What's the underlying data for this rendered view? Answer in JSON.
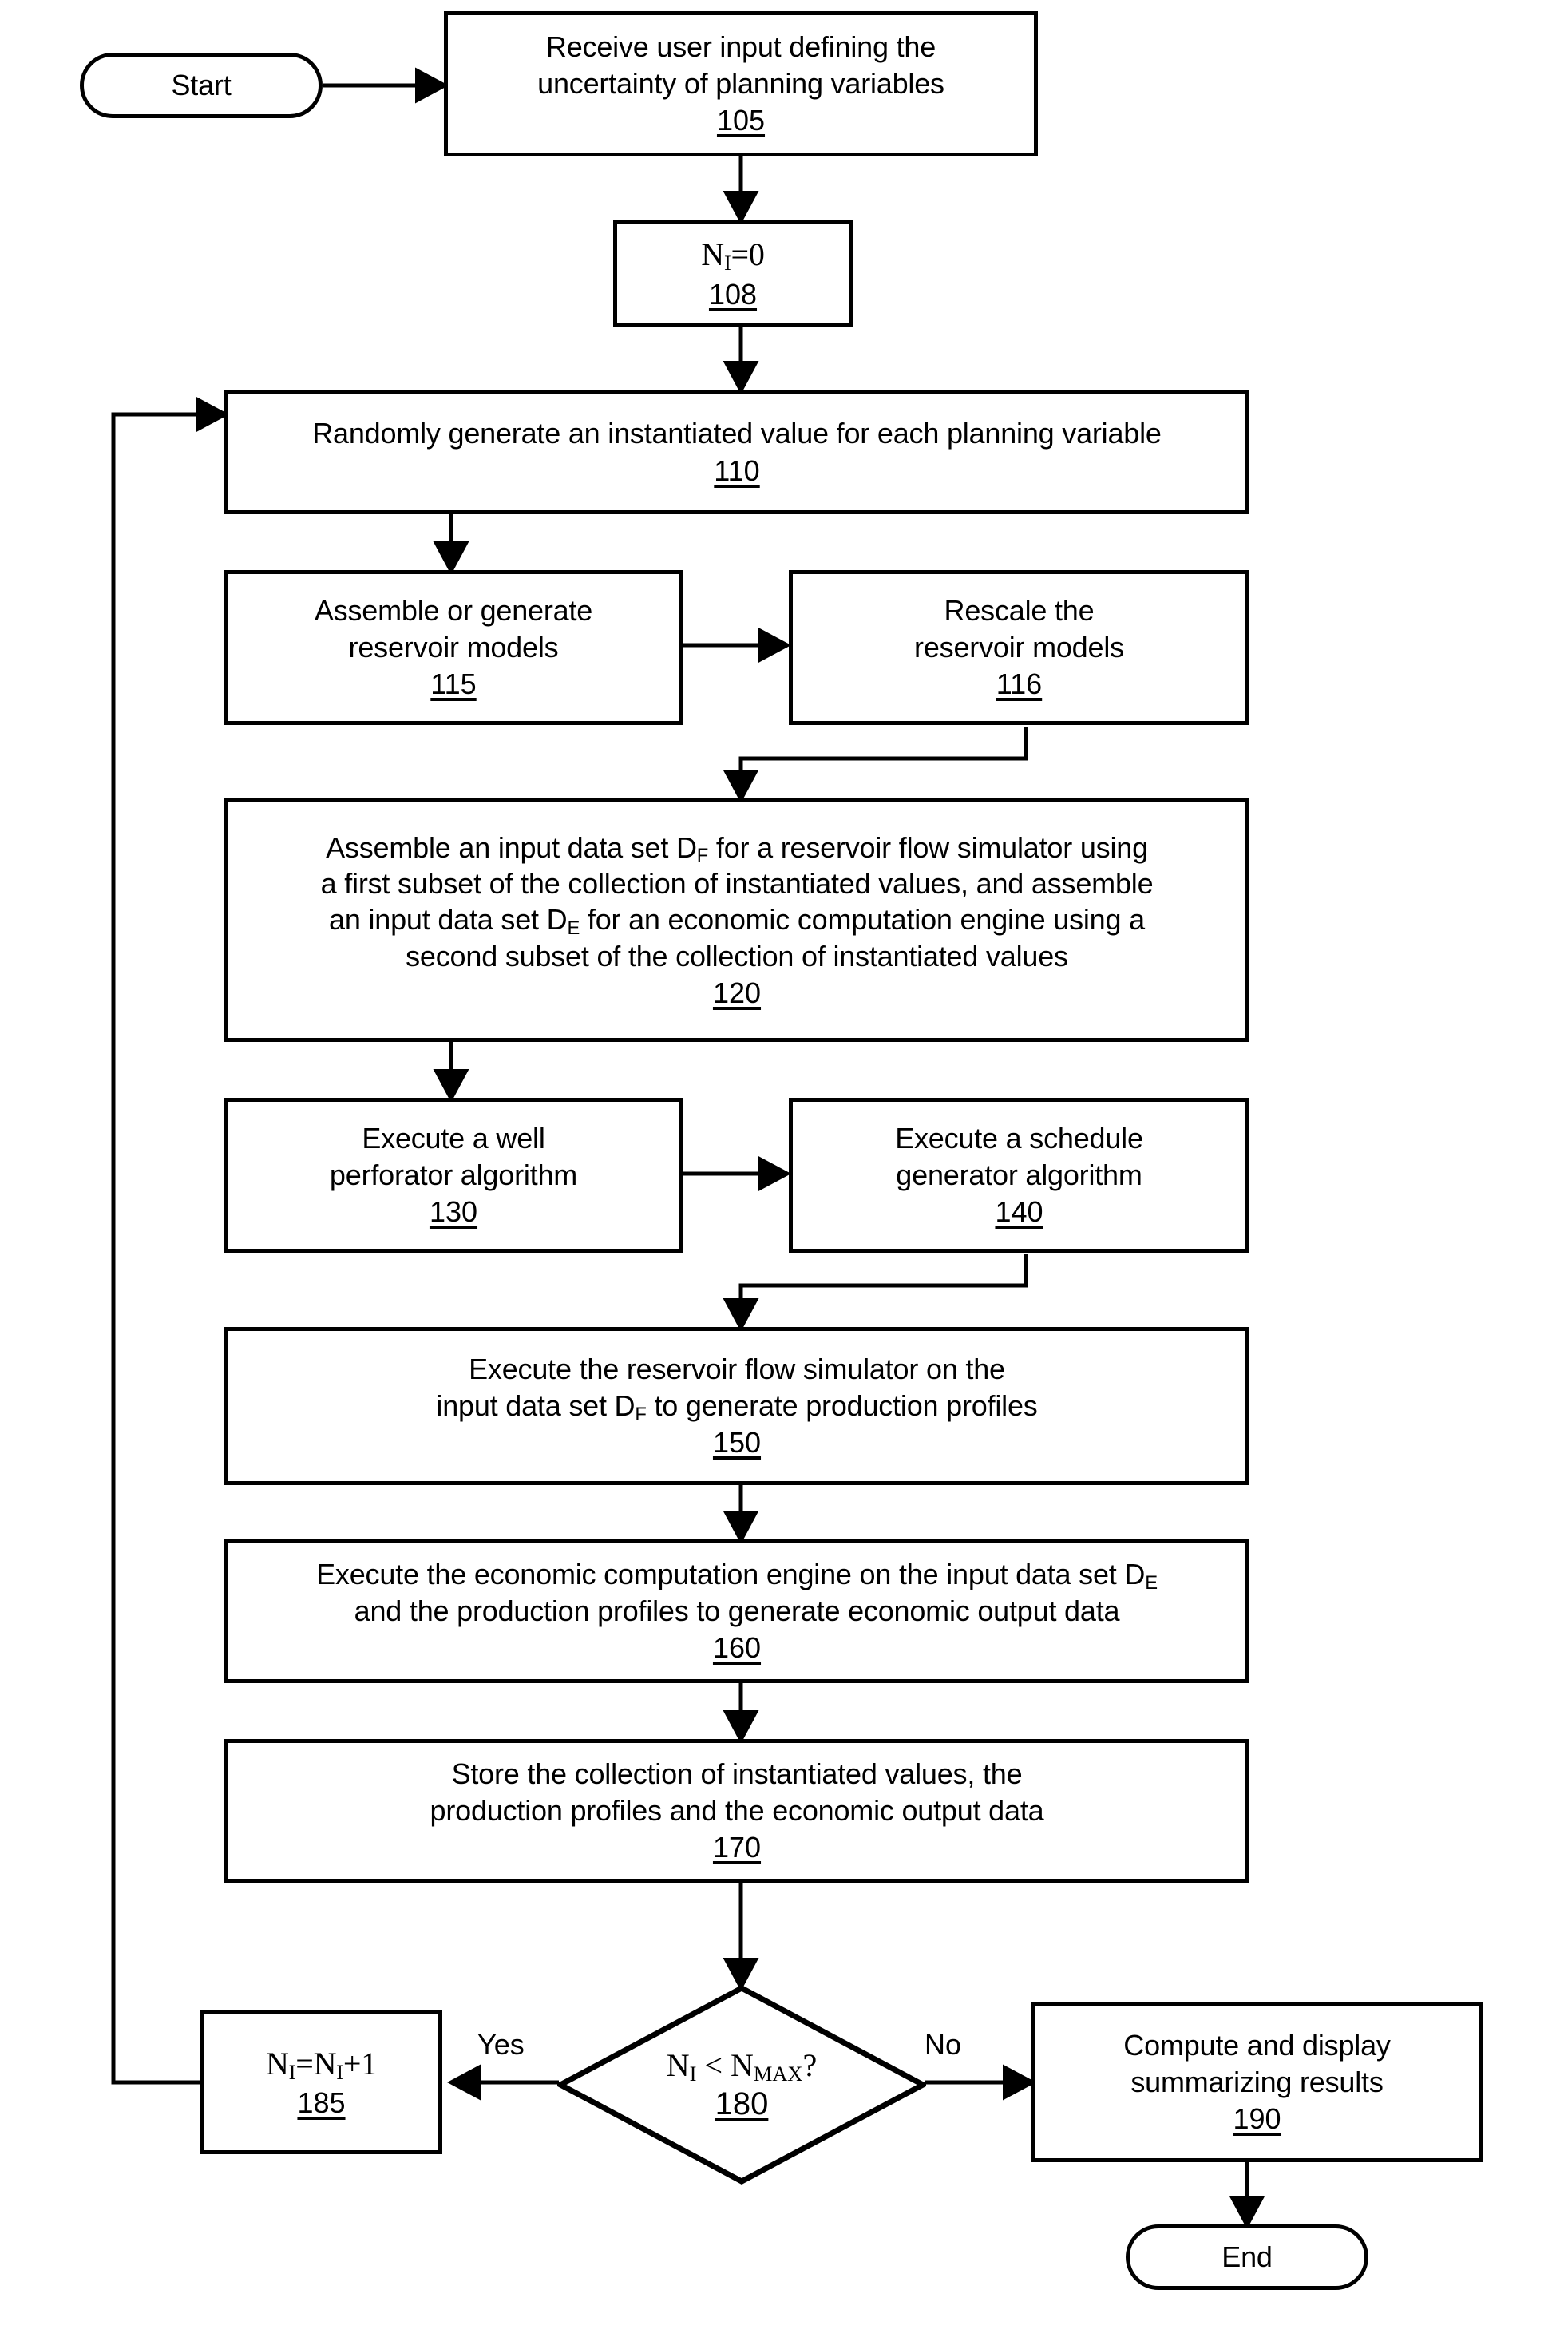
{
  "figure": {
    "type": "flowchart",
    "orientation": "vertical",
    "background_color": "#ffffff",
    "line_color": "#000000"
  },
  "nodes": {
    "start": {
      "shape": "terminator",
      "label": "Start"
    },
    "n105": {
      "shape": "process",
      "text": "Receive user input defining the\nuncertainty of planning variables",
      "ref": "105"
    },
    "n108": {
      "shape": "process",
      "text": "N_I=0",
      "ref": "108"
    },
    "n110": {
      "shape": "process",
      "text": "Randomly generate an instantiated value for each planning variable",
      "ref": "110"
    },
    "n115": {
      "shape": "process",
      "text": "Assemble or generate\nreservoir models",
      "ref": "115"
    },
    "n116": {
      "shape": "process",
      "text": "Rescale the\nreservoir models",
      "ref": "116"
    },
    "n120": {
      "shape": "process",
      "text": "Assemble an input data set D_F for a reservoir flow simulator using\na first subset of the collection of instantiated values, and assemble\nan input data set D_E for an economic computation engine using a\nsecond subset of the collection of instantiated values",
      "ref": "120"
    },
    "n130": {
      "shape": "process",
      "text": "Execute a well\nperforator algorithm",
      "ref": "130"
    },
    "n140": {
      "shape": "process",
      "text": "Execute a schedule\ngenerator algorithm",
      "ref": "140"
    },
    "n150": {
      "shape": "process",
      "text": "Execute the reservoir flow simulator on the\ninput data set D_F to generate production profiles",
      "ref": "150"
    },
    "n160": {
      "shape": "process",
      "text": "Execute the economic computation engine on the input data set D_E\nand the production profiles to generate economic output data",
      "ref": "160"
    },
    "n170": {
      "shape": "process",
      "text": "Store the collection of instantiated values, the\nproduction profiles and the economic output data",
      "ref": "170"
    },
    "n180": {
      "shape": "decision",
      "text": "N_I < N_MAX?",
      "ref": "180"
    },
    "n185": {
      "shape": "process",
      "text": "N_I=N_I+1",
      "ref": "185"
    },
    "n190": {
      "shape": "process",
      "text": "Compute and display\nsummarizing results",
      "ref": "190"
    },
    "end": {
      "shape": "terminator",
      "label": "End"
    }
  },
  "edge_labels": {
    "yes": "Yes",
    "no": "No"
  },
  "edges": [
    {
      "from": "start",
      "to": "n105"
    },
    {
      "from": "n105",
      "to": "n108"
    },
    {
      "from": "n108",
      "to": "n110"
    },
    {
      "from": "n110",
      "to": "n115"
    },
    {
      "from": "n115",
      "to": "n116"
    },
    {
      "from": "n116",
      "to": "n120"
    },
    {
      "from": "n120",
      "to": "n130"
    },
    {
      "from": "n130",
      "to": "n140"
    },
    {
      "from": "n140",
      "to": "n150"
    },
    {
      "from": "n150",
      "to": "n160"
    },
    {
      "from": "n160",
      "to": "n170"
    },
    {
      "from": "n170",
      "to": "n180"
    },
    {
      "from": "n180",
      "to": "n185",
      "label": "Yes"
    },
    {
      "from": "n180",
      "to": "n190",
      "label": "No"
    },
    {
      "from": "n185",
      "to": "n110"
    },
    {
      "from": "n190",
      "to": "end"
    }
  ]
}
